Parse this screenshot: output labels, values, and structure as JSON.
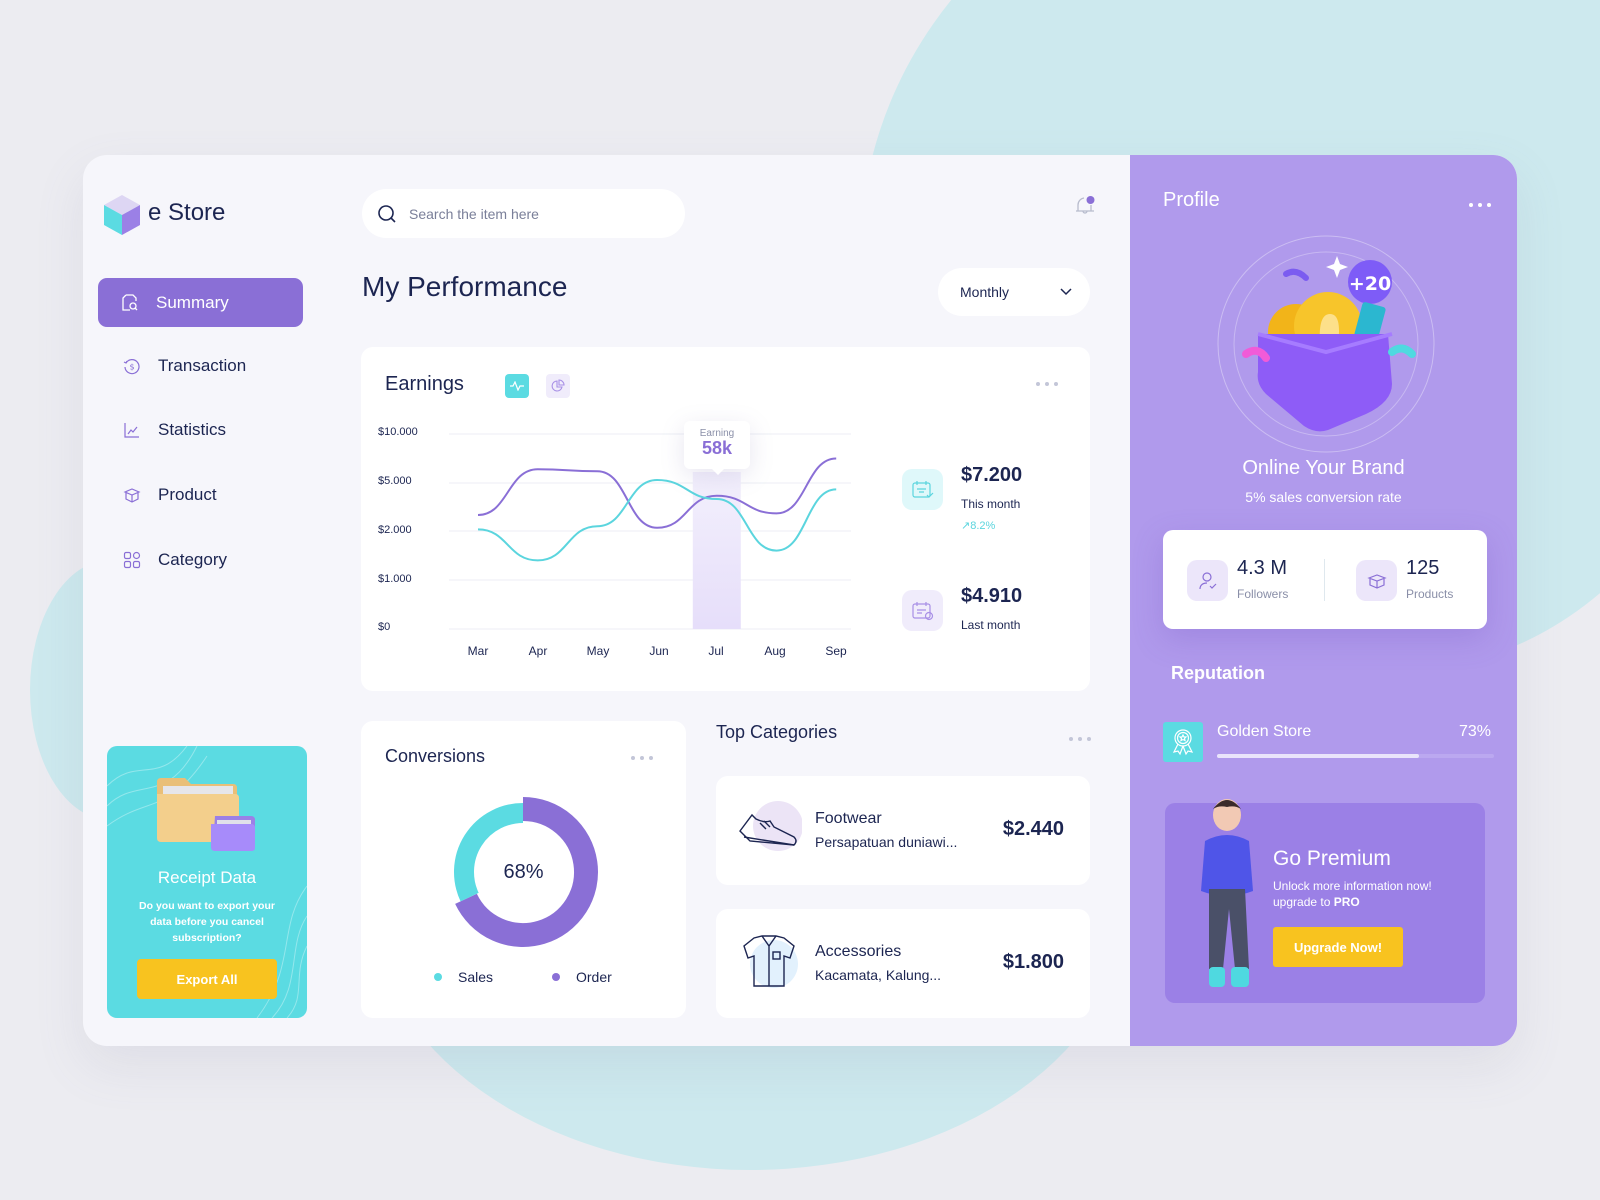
{
  "app": {
    "brand": "e Store"
  },
  "sidebar": {
    "items": [
      {
        "label": "Summary",
        "icon": "document-search-icon",
        "active": true
      },
      {
        "label": "Transaction",
        "icon": "money-refresh-icon",
        "active": false
      },
      {
        "label": "Statistics",
        "icon": "chart-line-icon",
        "active": false
      },
      {
        "label": "Product",
        "icon": "box-icon",
        "active": false
      },
      {
        "label": "Category",
        "icon": "grid-icon",
        "active": false
      }
    ],
    "receipt": {
      "title": "Receipt Data",
      "description": "Do you want to export your data before you cancel subscription?",
      "button": "Export All"
    }
  },
  "header": {
    "search_placeholder": "Search the item here",
    "search_value": "",
    "notification_unread": true
  },
  "main": {
    "title": "My Performance",
    "period": "Monthly"
  },
  "earnings": {
    "title": "Earnings",
    "tooltip": {
      "label": "Earning",
      "value": "58k",
      "month": "Jul"
    },
    "this_month": {
      "value": "$7.200",
      "label": "This month",
      "change": "8.2%"
    },
    "last_month": {
      "value": "$4.910",
      "label": "Last month"
    }
  },
  "chart_data": [
    {
      "type": "line",
      "title": "Earnings",
      "categories": [
        "Mar",
        "Apr",
        "May",
        "Jun",
        "Jul",
        "Aug",
        "Sep"
      ],
      "y_tick_labels": [
        "$0",
        "$1.000",
        "$2.000",
        "$5.000",
        "$10.000"
      ],
      "y_ticks": [
        0,
        1000,
        2000,
        5000,
        10000
      ],
      "ylim": [
        0,
        10000
      ],
      "grid": true,
      "highlight_category": "Jul",
      "series": [
        {
          "name": "series-purple",
          "color": "#8a6fd6",
          "values": [
            3000,
            6400,
            6200,
            2200,
            4200,
            3100,
            7500
          ]
        },
        {
          "name": "series-teal",
          "color": "#5bd5de",
          "values": [
            2100,
            1400,
            2300,
            5300,
            4000,
            1600,
            4600
          ]
        }
      ]
    },
    {
      "type": "pie",
      "title": "Conversions",
      "center_label": "68%",
      "legend_position": "bottom",
      "slices": [
        {
          "name": "Sales",
          "value": 32,
          "color": "#5bdbe2"
        },
        {
          "name": "Order",
          "value": 68,
          "color": "#8a6fd6"
        }
      ]
    }
  ],
  "conversions": {
    "title": "Conversions",
    "center": "68%",
    "legend": [
      "Sales",
      "Order"
    ]
  },
  "top_categories": {
    "title": "Top Categories",
    "items": [
      {
        "name": "Footwear",
        "description": "Persapatuan duniawi...",
        "price": "$2.440",
        "icon": "sneaker-icon"
      },
      {
        "name": "Accessories",
        "description": "Kacamata, Kalung...",
        "price": "$1.800",
        "icon": "shirt-icon"
      }
    ]
  },
  "profile": {
    "title": "Profile",
    "badge": "+20",
    "headline": "Online Your Brand",
    "subline": "5% sales conversion rate",
    "followers": {
      "value": "4.3 M",
      "label": "Followers"
    },
    "products": {
      "value": "125",
      "label": "Products"
    },
    "reputation": {
      "title": "Reputation",
      "name": "Golden Store",
      "percent_label": "73%",
      "percent": 73
    },
    "premium": {
      "title": "Go Premium",
      "line1": "Unlock more information now!",
      "line2_prefix": "upgrade to ",
      "line2_bold": "PRO",
      "button": "Upgrade Now!"
    }
  },
  "colors": {
    "accent": "#8a6fd6",
    "teal": "#5bdbe2",
    "yellow": "#f8c31f",
    "text": "#1c2551",
    "panel": "#b09aec"
  }
}
